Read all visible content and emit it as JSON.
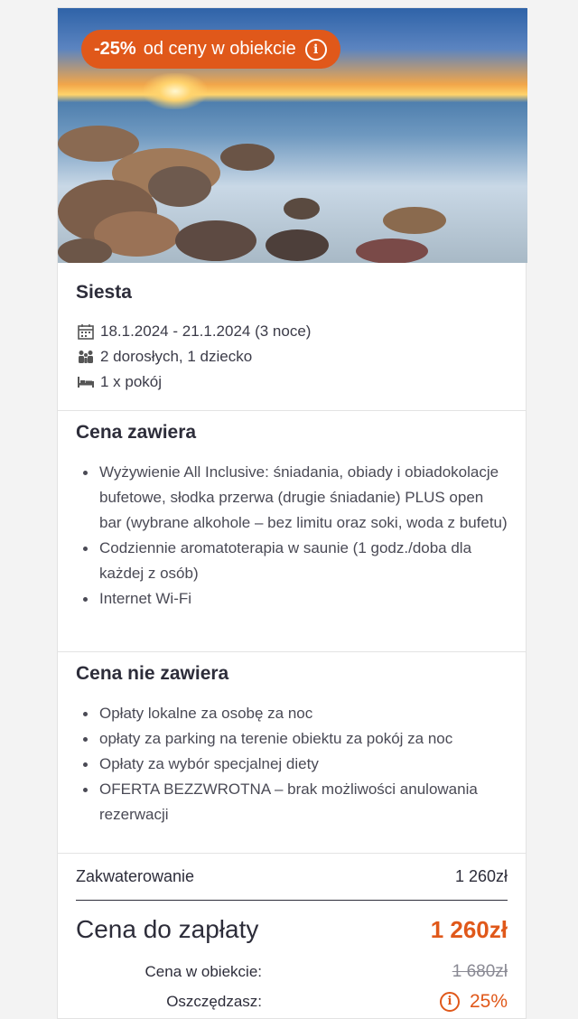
{
  "offer": {
    "discount_pct": "-25%",
    "discount_text": "od ceny w obiekcie",
    "hero_image": "sea-rocks-sunset-photo"
  },
  "hotel": {
    "name": "Siesta",
    "dates": "18.1.2024 - 21.1.2024 (3 noce)",
    "guests": "2 dorosłych,  1 dziecko",
    "rooms": "1 x pokój"
  },
  "includes": {
    "title": "Cena zawiera",
    "items": [
      "Wyżywienie All Inclusive: śniadania, obiady i obiadokolacje bufetowe, słodka przerwa (drugie śniadanie) PLUS open bar (wybrane alkohole – bez limitu oraz soki, woda z bufetu)",
      "Codziennie aromatoterapia w saunie (1 godz./doba dla każdej z osób)",
      "Internet Wi-Fi"
    ]
  },
  "excludes": {
    "title": "Cena nie zawiera",
    "items": [
      "Opłaty lokalne za osobę za noc",
      "opłaty za parking na terenie obiektu za pokój za noc",
      "Opłaty za wybór specjalnej diety",
      "OFERTA BEZZWROTNA – brak możliwości anulowania rezerwacji"
    ]
  },
  "pricing": {
    "accommodation_label": "Zakwaterowanie",
    "accommodation_value": "1 260zł",
    "total_label": "Cena do zapłaty",
    "total_value": "1 260zł",
    "hotel_price_label": "Cena w obiekcie:",
    "hotel_price_value": "1 680zł",
    "savings_label": "Oszczędzasz:",
    "savings_value": "25%"
  },
  "colors": {
    "accent": "#e0581a",
    "text": "#2d2d3a"
  },
  "icons": [
    "info-icon",
    "calendar-icon",
    "people-icon",
    "bed-icon"
  ]
}
